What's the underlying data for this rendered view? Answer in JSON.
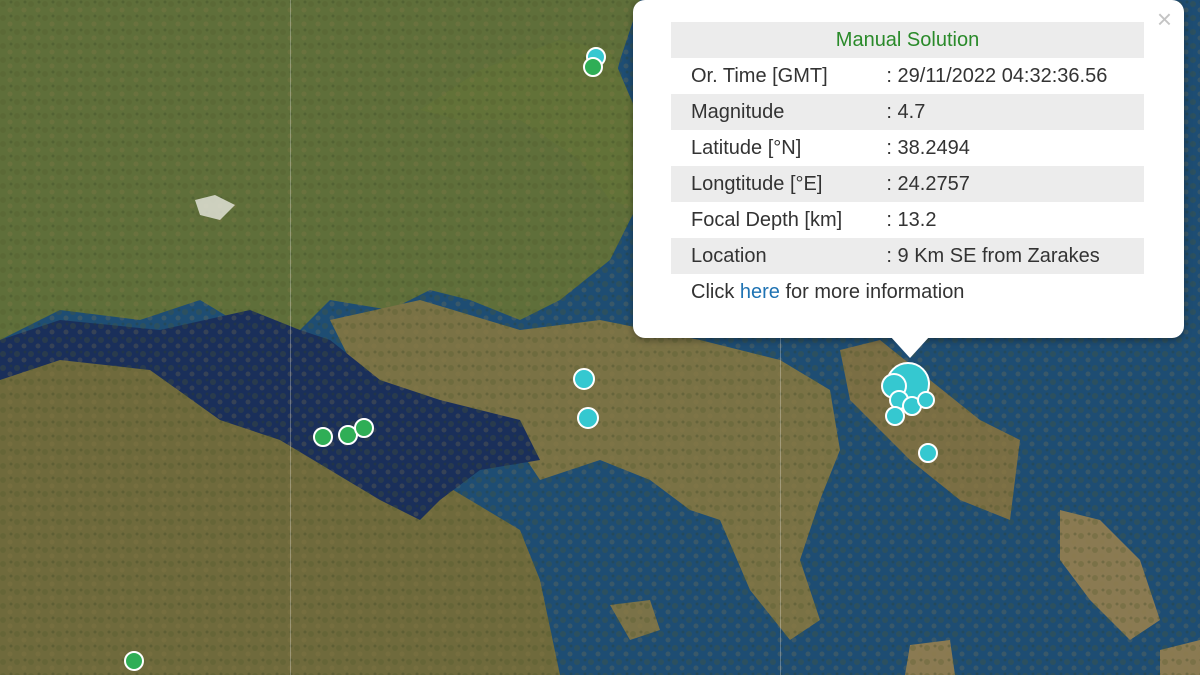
{
  "popup": {
    "title": "Manual Solution",
    "close_glyph": "×",
    "rows": [
      {
        "label": "Or. Time [GMT]",
        "value": ": 29/11/2022 04:32:36.56"
      },
      {
        "label": "Magnitude",
        "value": ": 4.7"
      },
      {
        "label": "Latitude [°N]",
        "value": ": 38.2494"
      },
      {
        "label": "Longtitude [°E]",
        "value": ": 24.2757"
      },
      {
        "label": "Focal Depth [km]",
        "value": ": 13.2"
      },
      {
        "label": "Location",
        "value": ": 9 Km SE from Zarakes"
      }
    ],
    "more_prefix": "Click ",
    "more_link": "here",
    "more_suffix": " for more information"
  },
  "colors": {
    "recent_quake": "#35c8d0",
    "older_quake": "#2fae56",
    "title_green": "#2a8a2a",
    "link_blue": "#1f73b3"
  }
}
